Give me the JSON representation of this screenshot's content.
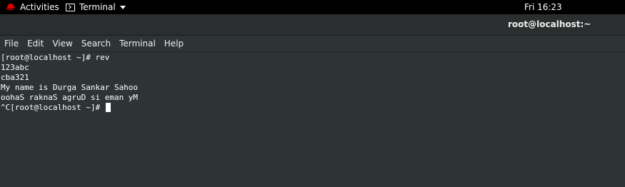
{
  "topbar": {
    "activities_label": "Activities",
    "app_menu_label": "Terminal",
    "clock": "Fri 16:23",
    "icons": {
      "activities": "redhat-logo-icon",
      "app": "terminal-icon",
      "app_menu_arrow": "chevron-down-icon"
    },
    "colors": {
      "background": "#000000",
      "text": "#ffffff",
      "logo": "#e00000"
    }
  },
  "window": {
    "title": "root@localhost:~"
  },
  "menubar": {
    "items": [
      "File",
      "Edit",
      "View",
      "Search",
      "Terminal",
      "Help"
    ]
  },
  "terminal": {
    "background": "#2e3436",
    "foreground": "#ffffff",
    "lines": [
      "[root@localhost ~]# rev",
      "123abc",
      "cba321",
      "My name is Durga Sankar Sahoo",
      "oohaS raknaS agruD si eman yM",
      "^C[root@localhost ~]# "
    ]
  }
}
